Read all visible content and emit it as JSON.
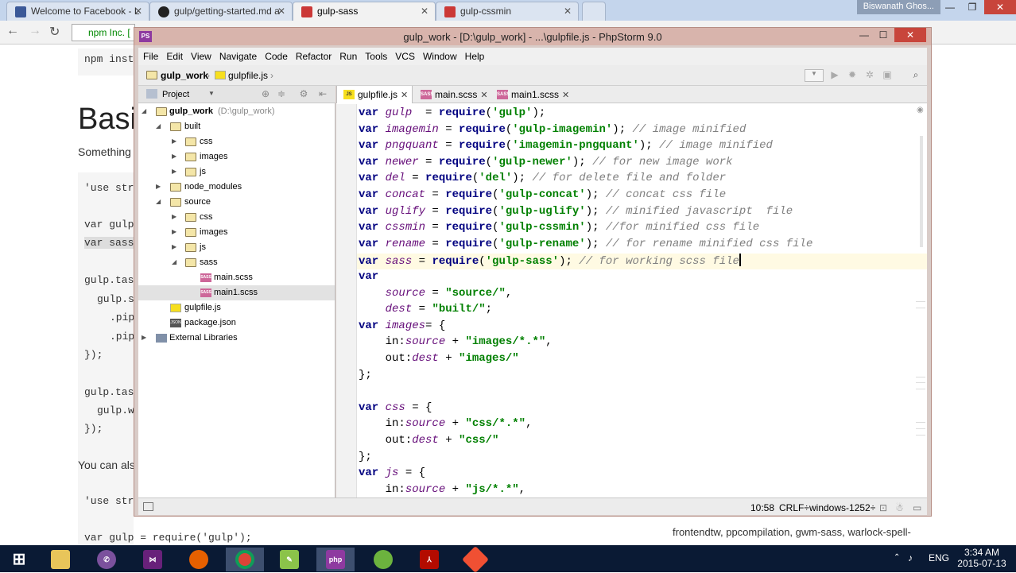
{
  "browser": {
    "tabs": [
      {
        "label": "Welcome to Facebook - L",
        "color": "#3b5998"
      },
      {
        "label": "gulp/getting-started.md a",
        "color": "#222222"
      },
      {
        "label": "gulp-sass",
        "color": "#cb3837"
      },
      {
        "label": "gulp-cssmin",
        "color": "#cb3837"
      }
    ],
    "user": "Biswanath Ghos...",
    "omnibox": "npm Inc. [",
    "page": {
      "cmd_snippet": "npm inst",
      "heading": "Basi",
      "sub": "Something",
      "use_strict_1": "'use str",
      "var_gulp": "var gulp",
      "var_sass": "var sass",
      "gulp_task_1": "gulp.tas",
      "gulp_s": "gulp.s",
      "pip1": ".pip",
      "pip2": ".pip",
      "close1": "});",
      "gulp_task_2": "gulp.tas",
      "gulp_w": "gulp.w",
      "close2": "});",
      "you_can": "You can also",
      "use_strict_2": "'use str",
      "var_gulp_req": "var gulp = require('gulp');",
      "tags": "frontendtw, ppcompilation, gwm-sass, warlock-spell-"
    }
  },
  "ide": {
    "title": "gulp_work - [D:\\gulp_work] - ...\\gulpfile.js - PhpStorm 9.0",
    "menu": [
      "File",
      "Edit",
      "View",
      "Navigate",
      "Code",
      "Refactor",
      "Run",
      "Tools",
      "VCS",
      "Window",
      "Help"
    ],
    "breadcrumb": [
      "gulp_work",
      "gulpfile.js"
    ],
    "project_label": "Project",
    "tree": [
      {
        "label": "gulp_work",
        "extra": "(D:\\gulp_work)"
      },
      {
        "label": "built"
      },
      {
        "label": "css"
      },
      {
        "label": "images"
      },
      {
        "label": "js"
      },
      {
        "label": "node_modules"
      },
      {
        "label": "source"
      },
      {
        "label": "css"
      },
      {
        "label": "images"
      },
      {
        "label": "js"
      },
      {
        "label": "sass"
      },
      {
        "label": "main.scss"
      },
      {
        "label": "main1.scss"
      },
      {
        "label": "gulpfile.js"
      },
      {
        "label": "package.json"
      },
      {
        "label": "External Libraries"
      }
    ],
    "editor_tabs": [
      "gulpfile.js",
      "main.scss",
      "main1.scss"
    ],
    "code": [
      [
        [
          "kw",
          "var "
        ],
        [
          "vr",
          "gulp"
        ],
        [
          "",
          "  = "
        ],
        [
          "kw",
          "require"
        ],
        [
          "",
          "("
        ],
        [
          "st",
          "'gulp'"
        ],
        [
          "",
          ");"
        ]
      ],
      [
        [
          "kw",
          "var "
        ],
        [
          "vr",
          "imagemin"
        ],
        [
          "",
          " = "
        ],
        [
          "kw",
          "require"
        ],
        [
          "",
          "("
        ],
        [
          "st",
          "'gulp-imagemin'"
        ],
        [
          "",
          "); "
        ],
        [
          "cm",
          "// image minified"
        ]
      ],
      [
        [
          "kw",
          "var "
        ],
        [
          "vr",
          "pngquant"
        ],
        [
          "",
          " = "
        ],
        [
          "kw",
          "require"
        ],
        [
          "",
          "("
        ],
        [
          "st",
          "'imagemin-pngquant'"
        ],
        [
          "",
          "); "
        ],
        [
          "cm",
          "// image minified"
        ]
      ],
      [
        [
          "kw",
          "var "
        ],
        [
          "vr",
          "newer"
        ],
        [
          "",
          " = "
        ],
        [
          "kw",
          "require"
        ],
        [
          "",
          "("
        ],
        [
          "st",
          "'gulp-newer'"
        ],
        [
          "",
          "); "
        ],
        [
          "cm",
          "// for new image work"
        ]
      ],
      [
        [
          "kw",
          "var "
        ],
        [
          "vr",
          "del"
        ],
        [
          "",
          " = "
        ],
        [
          "kw",
          "require"
        ],
        [
          "",
          "("
        ],
        [
          "st",
          "'del'"
        ],
        [
          "",
          "); "
        ],
        [
          "cm",
          "// for delete file and folder"
        ]
      ],
      [
        [
          "kw",
          "var "
        ],
        [
          "vr",
          "concat"
        ],
        [
          "",
          " = "
        ],
        [
          "kw",
          "require"
        ],
        [
          "",
          "("
        ],
        [
          "st",
          "'gulp-concat'"
        ],
        [
          "",
          "); "
        ],
        [
          "cm",
          "// concat css file"
        ]
      ],
      [
        [
          "kw",
          "var "
        ],
        [
          "vr",
          "uglify"
        ],
        [
          "",
          " = "
        ],
        [
          "kw",
          "require"
        ],
        [
          "",
          "("
        ],
        [
          "st",
          "'gulp-uglify'"
        ],
        [
          "",
          "); "
        ],
        [
          "cm",
          "// minified javascript  file"
        ]
      ],
      [
        [
          "kw",
          "var "
        ],
        [
          "vr",
          "cssmin"
        ],
        [
          "",
          " = "
        ],
        [
          "kw",
          "require"
        ],
        [
          "",
          "("
        ],
        [
          "st",
          "'gulp-cssmin'"
        ],
        [
          "",
          "); "
        ],
        [
          "cm",
          "//for minified css file"
        ]
      ],
      [
        [
          "kw",
          "var "
        ],
        [
          "vr",
          "rename"
        ],
        [
          "",
          " = "
        ],
        [
          "kw",
          "require"
        ],
        [
          "",
          "("
        ],
        [
          "st",
          "'gulp-rename'"
        ],
        [
          "",
          "); "
        ],
        [
          "cm",
          "// for rename minified css file"
        ]
      ],
      [
        [
          "kw",
          "var "
        ],
        [
          "vr",
          "sass"
        ],
        [
          "",
          " = "
        ],
        [
          "kw",
          "require"
        ],
        [
          "",
          "("
        ],
        [
          "st",
          "'gulp-sass'"
        ],
        [
          "",
          "); "
        ],
        [
          "cm",
          "// for working scss file"
        ]
      ],
      [
        [
          "kw",
          "var"
        ]
      ],
      [
        [
          "",
          "    "
        ],
        [
          "vr",
          "source"
        ],
        [
          "",
          " = "
        ],
        [
          "st",
          "\"source/\""
        ],
        [
          "",
          ","
        ]
      ],
      [
        [
          "",
          "    "
        ],
        [
          "vr",
          "dest"
        ],
        [
          "",
          " = "
        ],
        [
          "st",
          "\"built/\""
        ],
        [
          "",
          ";"
        ]
      ],
      [
        [
          "kw",
          "var "
        ],
        [
          "vr",
          "images"
        ],
        [
          "",
          "= {"
        ]
      ],
      [
        [
          "",
          "    in:"
        ],
        [
          "vr",
          "source"
        ],
        [
          "",
          " + "
        ],
        [
          "st",
          "\"images/*.*\""
        ],
        [
          "",
          ","
        ]
      ],
      [
        [
          "",
          "    out:"
        ],
        [
          "vr",
          "dest"
        ],
        [
          "",
          " + "
        ],
        [
          "st",
          "\"images/\""
        ]
      ],
      [
        [
          "",
          "};"
        ]
      ],
      [
        [
          "",
          ""
        ]
      ],
      [
        [
          "kw",
          "var "
        ],
        [
          "vr",
          "css"
        ],
        [
          "",
          " = {"
        ]
      ],
      [
        [
          "",
          "    in:"
        ],
        [
          "vr",
          "source"
        ],
        [
          "",
          " + "
        ],
        [
          "st",
          "\"css/*.*\""
        ],
        [
          "",
          ","
        ]
      ],
      [
        [
          "",
          "    out:"
        ],
        [
          "vr",
          "dest"
        ],
        [
          "",
          " + "
        ],
        [
          "st",
          "\"css/\""
        ]
      ],
      [
        [
          "",
          "};"
        ]
      ],
      [
        [
          "kw",
          "var "
        ],
        [
          "vr",
          "js"
        ],
        [
          "",
          " = {"
        ]
      ],
      [
        [
          "",
          "    in:"
        ],
        [
          "vr",
          "source"
        ],
        [
          "",
          " + "
        ],
        [
          "st",
          "\"js/*.*\""
        ],
        [
          "",
          ","
        ]
      ]
    ],
    "status": {
      "position": "10:58",
      "line_sep": "CRLF÷",
      "encoding": "windows-1252÷"
    }
  },
  "taskbar": {
    "lang": "ENG",
    "time": "3:34 AM",
    "date": "2015-07-13"
  }
}
